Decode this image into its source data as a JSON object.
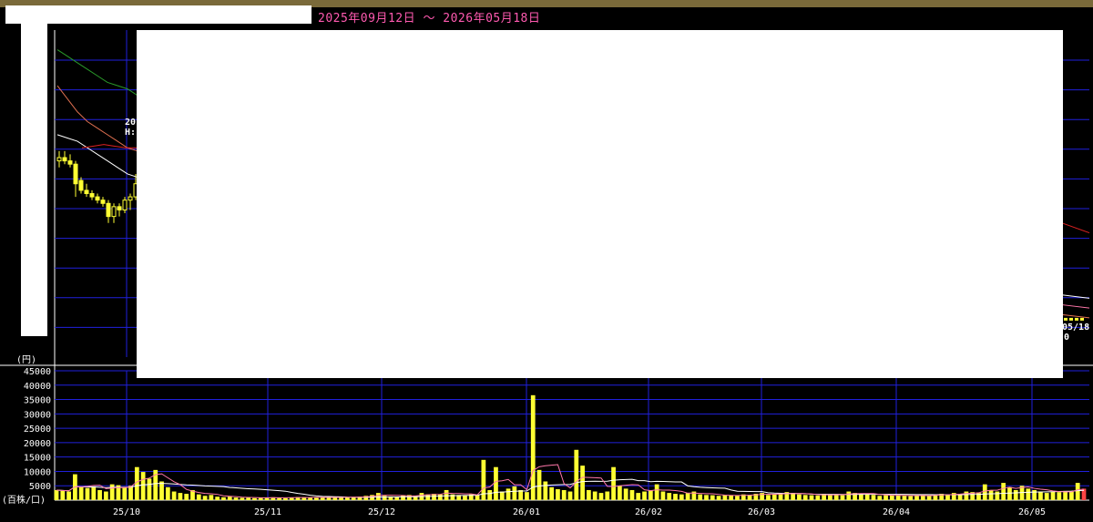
{
  "header": {
    "date_range": "2025年09月12日 ～ 2026年05月18日"
  },
  "price_panel": {
    "unit_label": "(円)",
    "candles": [
      {
        "o": 0.6,
        "h": 0.63,
        "l": 0.58,
        "c": 0.61,
        "up": true
      },
      {
        "o": 0.61,
        "h": 0.63,
        "l": 0.59,
        "c": 0.6,
        "up": false
      },
      {
        "o": 0.6,
        "h": 0.62,
        "l": 0.58,
        "c": 0.59,
        "up": false
      },
      {
        "o": 0.59,
        "h": 0.6,
        "l": 0.49,
        "c": 0.53,
        "up": false
      },
      {
        "o": 0.54,
        "h": 0.55,
        "l": 0.5,
        "c": 0.51,
        "up": false
      },
      {
        "o": 0.51,
        "h": 0.53,
        "l": 0.49,
        "c": 0.5,
        "up": false
      },
      {
        "o": 0.5,
        "h": 0.51,
        "l": 0.48,
        "c": 0.49,
        "up": false
      },
      {
        "o": 0.49,
        "h": 0.5,
        "l": 0.47,
        "c": 0.48,
        "up": false
      },
      {
        "o": 0.48,
        "h": 0.49,
        "l": 0.46,
        "c": 0.47,
        "up": false
      },
      {
        "o": 0.47,
        "h": 0.48,
        "l": 0.41,
        "c": 0.43,
        "up": false
      },
      {
        "o": 0.43,
        "h": 0.47,
        "l": 0.41,
        "c": 0.46,
        "up": true
      },
      {
        "o": 0.46,
        "h": 0.47,
        "l": 0.43,
        "c": 0.45,
        "up": false
      },
      {
        "o": 0.45,
        "h": 0.49,
        "l": 0.44,
        "c": 0.48,
        "up": true
      },
      {
        "o": 0.48,
        "h": 0.5,
        "l": 0.45,
        "c": 0.49,
        "up": true
      },
      {
        "o": 0.49,
        "h": 0.56,
        "l": 0.48,
        "c": 0.53,
        "up": true
      }
    ],
    "ma_green": [
      0.94,
      0.92,
      0.9,
      0.88,
      0.86,
      0.84,
      0.83,
      0.82,
      0.8
    ],
    "ma_orange": [
      0.83,
      0.79,
      0.75,
      0.72,
      0.7,
      0.68,
      0.66,
      0.64,
      0.63
    ],
    "ma_white": [
      0.68,
      0.67,
      0.66,
      0.64,
      0.62,
      0.6,
      0.58,
      0.56,
      0.55
    ],
    "ma_red_flat": [
      0.64,
      0.645,
      0.65,
      0.645,
      0.64,
      0.64
    ],
    "last_label": "05/18",
    "last_value": "0",
    "annotation_1": "20",
    "annotation_2": "H:"
  },
  "volume_panel": {
    "unit_label": "(百株/口)",
    "y_ticks": [
      "45000",
      "40000",
      "35000",
      "30000",
      "25000",
      "20000",
      "15000",
      "10000",
      "5000"
    ]
  },
  "x_axis": {
    "labels": [
      "25/10",
      "25/11",
      "25/12",
      "26/01",
      "26/02",
      "26/03",
      "26/04",
      "26/05"
    ]
  },
  "chart_data": {
    "type": "bar",
    "title": "",
    "xlabel": "",
    "ylabel": "(百株/口)",
    "ylim": [
      0,
      45000
    ],
    "x_tick_labels": [
      "25/10",
      "25/11",
      "25/12",
      "26/01",
      "26/02",
      "26/03",
      "26/04",
      "26/05"
    ],
    "colors": {
      "volume_bar": "#ffff33",
      "ma_white": "#ffffff",
      "ma_pink": "#ff77aa",
      "grid": "#2020dd"
    },
    "volume": [
      3500,
      3200,
      3000,
      9000,
      4500,
      4200,
      4800,
      3500,
      3000,
      5500,
      5200,
      4500,
      5000,
      11500,
      9800,
      7500,
      10500,
      6500,
      4500,
      3000,
      2500,
      2200,
      3500,
      2000,
      1500,
      1800,
      1200,
      1000,
      1200,
      900,
      800,
      900,
      700,
      800,
      900,
      1000,
      800,
      700,
      900,
      1100,
      1000,
      900,
      800,
      900,
      1200,
      1000,
      900,
      1000,
      1100,
      1200,
      1500,
      1800,
      2500,
      1500,
      1300,
      1200,
      1600,
      1800,
      1500,
      2500,
      2000,
      2200,
      2000,
      3500,
      2000,
      1800,
      1600,
      2000,
      1700,
      14000,
      3500,
      11500,
      3000,
      4000,
      4800,
      3500,
      2800,
      36500,
      10500,
      6500,
      4500,
      3800,
      3500,
      3000,
      17500,
      12000,
      3500,
      3000,
      2500,
      3000,
      11500,
      5000,
      4000,
      3500,
      2500,
      3000,
      3500,
      5500,
      3000,
      2500,
      2200,
      2000,
      2500,
      3000,
      2000,
      1800,
      1700,
      1500,
      1800,
      1600,
      1500,
      2000,
      1800,
      2200,
      2500,
      1800,
      2000,
      2200,
      2800,
      2500,
      2000,
      1800,
      1700,
      1600,
      2200,
      1800,
      2000,
      1700,
      3000,
      2500,
      2200,
      2000,
      1800,
      1500,
      1700,
      1600,
      1800,
      1500,
      1400,
      1600,
      1800,
      1500,
      2000,
      2200,
      1800,
      2500,
      2000,
      3000,
      2800,
      2500,
      5500,
      3500,
      3000,
      6000,
      4500,
      3500,
      5000,
      4000,
      3500,
      3000,
      2500,
      3000,
      2800,
      3200,
      3000,
      6000,
      4000
    ]
  }
}
